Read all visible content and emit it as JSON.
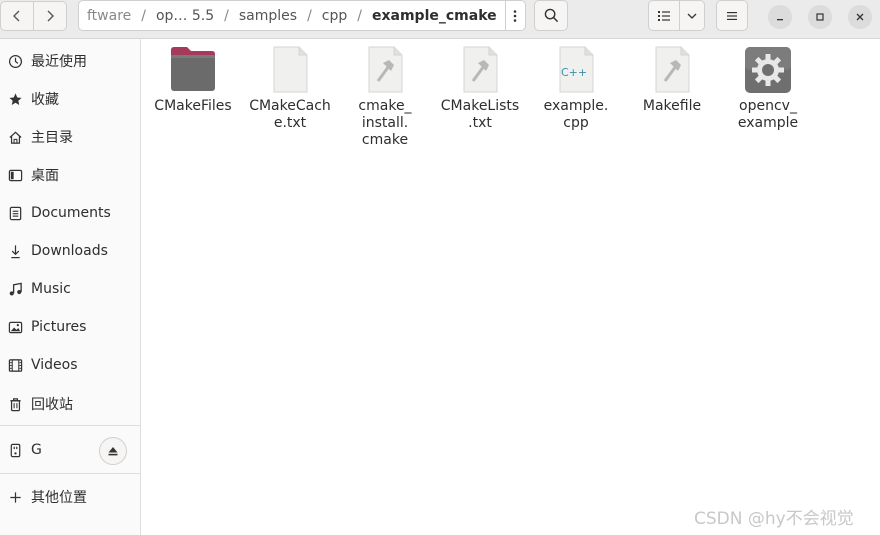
{
  "pathbar": {
    "crumbs": [
      "ftware",
      "op… 5.5",
      "samples",
      "cpp",
      "example_cmake"
    ],
    "separator": "/"
  },
  "sidebar": {
    "items": [
      {
        "label": "最近使用",
        "icon": "clock-icon"
      },
      {
        "label": "收藏",
        "icon": "star-icon"
      },
      {
        "label": "主目录",
        "icon": "home-icon"
      },
      {
        "label": "桌面",
        "icon": "desktop-icon"
      },
      {
        "label": "Documents",
        "icon": "document-icon"
      },
      {
        "label": "Downloads",
        "icon": "download-icon"
      },
      {
        "label": "Music",
        "icon": "music-icon"
      },
      {
        "label": "Pictures",
        "icon": "picture-icon"
      },
      {
        "label": "Videos",
        "icon": "video-icon"
      },
      {
        "label": "回收站",
        "icon": "trash-icon"
      }
    ],
    "device": {
      "label": "G",
      "icon": "usb-drive-icon"
    },
    "other": {
      "label": "其他位置",
      "icon": "plus-icon"
    }
  },
  "files": [
    {
      "name": "CMakeFiles",
      "type": "folder"
    },
    {
      "name": "CMakeCach\ne.txt",
      "type": "text"
    },
    {
      "name": "cmake_\ninstall.\ncmake",
      "type": "script"
    },
    {
      "name": "CMakeLists\n.txt",
      "type": "script"
    },
    {
      "name": "example.\ncpp",
      "type": "cpp",
      "badge": "C++"
    },
    {
      "name": "Makefile",
      "type": "script"
    },
    {
      "name": "opencv_\nexample",
      "type": "executable"
    }
  ],
  "watermark": "CSDN @hy不会视觉",
  "colors": {
    "folder": "#6b6b6b",
    "folder_tab": "#a53a5c",
    "cpp_badge": "#3a8fa8"
  }
}
